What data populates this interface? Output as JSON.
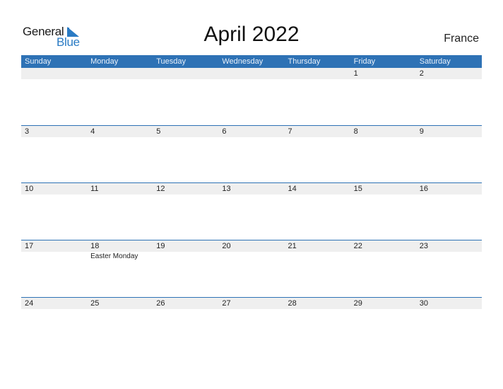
{
  "brand": {
    "line1": "General",
    "line2": "Blue",
    "accent": "#2a7bc4"
  },
  "title": "April 2022",
  "country": "France",
  "colors": {
    "header_bg": "#2e72b5",
    "date_strip": "#efefef"
  },
  "weekdays": [
    "Sunday",
    "Monday",
    "Tuesday",
    "Wednesday",
    "Thursday",
    "Friday",
    "Saturday"
  ],
  "weeks": [
    {
      "days": [
        {
          "date": ""
        },
        {
          "date": ""
        },
        {
          "date": ""
        },
        {
          "date": ""
        },
        {
          "date": ""
        },
        {
          "date": "1"
        },
        {
          "date": "2"
        }
      ]
    },
    {
      "days": [
        {
          "date": "3"
        },
        {
          "date": "4"
        },
        {
          "date": "5"
        },
        {
          "date": "6"
        },
        {
          "date": "7"
        },
        {
          "date": "8"
        },
        {
          "date": "9"
        }
      ]
    },
    {
      "days": [
        {
          "date": "10"
        },
        {
          "date": "11"
        },
        {
          "date": "12"
        },
        {
          "date": "13"
        },
        {
          "date": "14"
        },
        {
          "date": "15"
        },
        {
          "date": "16"
        }
      ]
    },
    {
      "days": [
        {
          "date": "17"
        },
        {
          "date": "18",
          "holiday": "Easter Monday"
        },
        {
          "date": "19"
        },
        {
          "date": "20"
        },
        {
          "date": "21"
        },
        {
          "date": "22"
        },
        {
          "date": "23"
        }
      ]
    },
    {
      "days": [
        {
          "date": "24"
        },
        {
          "date": "25"
        },
        {
          "date": "26"
        },
        {
          "date": "27"
        },
        {
          "date": "28"
        },
        {
          "date": "29"
        },
        {
          "date": "30"
        }
      ]
    }
  ]
}
